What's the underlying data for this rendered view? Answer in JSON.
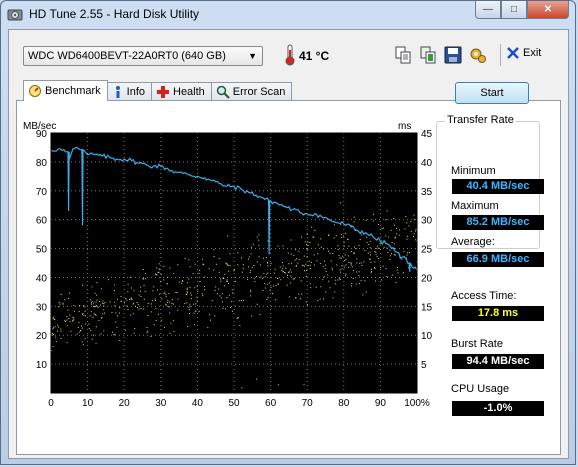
{
  "window": {
    "title": "HD Tune 2.55 - Hard Disk Utility",
    "controls": {
      "minimize": "—",
      "maximize": "□",
      "close": "✕"
    }
  },
  "toolbar": {
    "drive": "WDC WD6400BEVT-22A0RT0 (640 GB)",
    "temperature": "41 °C",
    "icons": [
      "copy-icon",
      "copy-info-icon",
      "save-icon",
      "options-icon"
    ],
    "exit_label": "Exit"
  },
  "tabs": [
    {
      "label": "Benchmark",
      "icon": "benchmark-icon",
      "active": true
    },
    {
      "label": "Info",
      "icon": "info-icon",
      "active": false
    },
    {
      "label": "Health",
      "icon": "health-icon",
      "active": false
    },
    {
      "label": "Error Scan",
      "icon": "search-icon",
      "active": false
    }
  ],
  "benchmark": {
    "start_label": "Start",
    "transfer_rate": {
      "title": "Transfer Rate",
      "min_label": "Minimum",
      "min_value": "40.4 MB/sec",
      "max_label": "Maximum",
      "max_value": "85.2 MB/sec",
      "avg_label": "Average:",
      "avg_value": "66.9 MB/sec"
    },
    "access_time": {
      "label": "Access Time:",
      "value": "17.8 ms"
    },
    "burst_rate": {
      "label": "Burst Rate",
      "value": "94.4 MB/sec"
    },
    "cpu_usage": {
      "label": "CPU Usage",
      "value": "-1.0%"
    }
  },
  "chart_data": {
    "type": "line",
    "left_axis_label": "MB/sec",
    "right_axis_label": "ms",
    "x_ticks": [
      "0",
      "10",
      "20",
      "30",
      "40",
      "50",
      "60",
      "70",
      "80",
      "90",
      "100%"
    ],
    "left_ticks": [
      "90",
      "80",
      "70",
      "60",
      "50",
      "40",
      "30",
      "20",
      "10"
    ],
    "right_ticks": [
      "45",
      "40",
      "35",
      "30",
      "25",
      "20",
      "15",
      "10",
      "5"
    ],
    "xlim": [
      0,
      100
    ],
    "ylim_left": [
      0,
      90
    ],
    "ylim_right": [
      0,
      45
    ],
    "grid": true,
    "background": "#000000",
    "series": [
      {
        "kind": "transfer-rate-line",
        "color": "#3aaeea",
        "x": [
          0,
          2,
          4,
          5,
          6,
          7,
          8,
          9,
          10,
          12,
          14,
          16,
          18,
          20,
          22,
          24,
          26,
          28,
          30,
          32,
          34,
          36,
          38,
          40,
          42,
          44,
          46,
          48,
          50,
          52,
          54,
          56,
          58,
          59.5,
          60,
          62,
          64,
          66,
          68,
          70,
          72,
          74,
          76,
          78,
          80,
          82,
          84,
          86,
          88,
          90,
          92,
          94,
          96,
          98,
          100
        ],
        "y": [
          84,
          84.5,
          83.5,
          81,
          84.5,
          85,
          84.2,
          84,
          82.5,
          82.5,
          82,
          81.5,
          81,
          81,
          80.5,
          79.5,
          79,
          78.5,
          78.5,
          77.5,
          76.5,
          76,
          75.5,
          75,
          74.5,
          73.5,
          72.5,
          71.5,
          71.5,
          70.5,
          69.5,
          68.5,
          67.5,
          66.5,
          66.5,
          65.5,
          64.5,
          63.5,
          62.5,
          62,
          62,
          61,
          60,
          59,
          58.5,
          57.5,
          56,
          55.5,
          54,
          52.5,
          51.5,
          49,
          47,
          45,
          42.5
        ],
        "dips": [
          {
            "x": 4.8,
            "y": 63
          },
          {
            "x": 8.6,
            "y": 58
          },
          {
            "x": 59.6,
            "y": 48
          },
          {
            "x": 98,
            "y": 42
          }
        ]
      },
      {
        "kind": "access-time-scatter",
        "color": "#e5e34a",
        "unit": "ms",
        "trend_min": [
          [
            0,
            7
          ],
          [
            50,
            11
          ],
          [
            100,
            19
          ]
        ],
        "trend_max": [
          [
            0,
            18
          ],
          [
            50,
            28
          ],
          [
            100,
            33
          ]
        ],
        "count": 700
      }
    ]
  }
}
